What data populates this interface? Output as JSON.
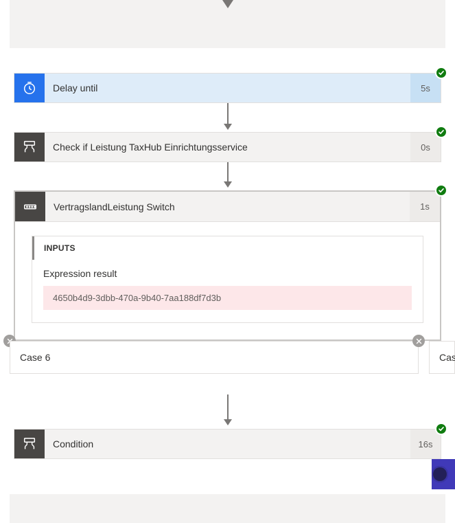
{
  "steps": {
    "delay": {
      "title": "Delay until",
      "duration": "5s",
      "status": "success"
    },
    "check": {
      "title": "Check if Leistung TaxHub Einrichtungsservice",
      "duration": "0s",
      "status": "success"
    },
    "switch": {
      "title": "VertragslandLeistung Switch",
      "duration": "1s",
      "status": "success",
      "inputs_heading": "INPUTS",
      "expression_label": "Expression result",
      "expression_value": "4650b4d9-3dbb-470a-9b40-7aa188df7d3b",
      "cases": [
        {
          "label": "Case 6"
        },
        {
          "label": "Case"
        }
      ]
    },
    "condition": {
      "title": "Condition",
      "duration": "16s",
      "status": "success"
    }
  }
}
